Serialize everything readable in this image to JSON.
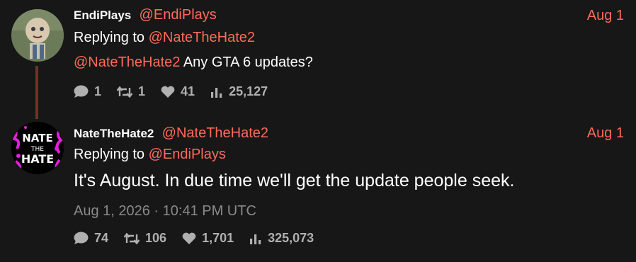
{
  "tweets": [
    {
      "name": "EndiPlays",
      "handle": "@EndiPlays",
      "date": "Aug 1",
      "replying_prefix": "Replying to",
      "replying_to": "@NateTheHate2",
      "text_mention": "@NateTheHate2",
      "text": " Any GTA 6 updates?",
      "stats": {
        "replies": "1",
        "retweets": "1",
        "likes": "41",
        "views": "25,127"
      },
      "icons": [
        "comment-icon",
        "retweet-icon",
        "heart-icon",
        "views-icon"
      ]
    },
    {
      "name": "NateTheHate2",
      "handle": "@NateTheHate2",
      "date": "Aug 1",
      "replying_prefix": "Replying to",
      "replying_to": "@EndiPlays",
      "text": "It's August. In due time we'll get the update people seek.",
      "timestamp": "Aug 1, 2026 · 10:41 PM UTC",
      "avatar_text": "NATE THE HATE",
      "stats": {
        "replies": "74",
        "retweets": "106",
        "likes": "1,701",
        "views": "325,073"
      },
      "icons": [
        "comment-icon",
        "retweet-icon",
        "heart-icon",
        "views-icon"
      ]
    }
  ],
  "colors": {
    "background": "#171717",
    "accent": "#ff6b5b",
    "thread_line": "#7a2d27",
    "muted": "#8a8a8a",
    "stats": "#b0b0b0"
  }
}
